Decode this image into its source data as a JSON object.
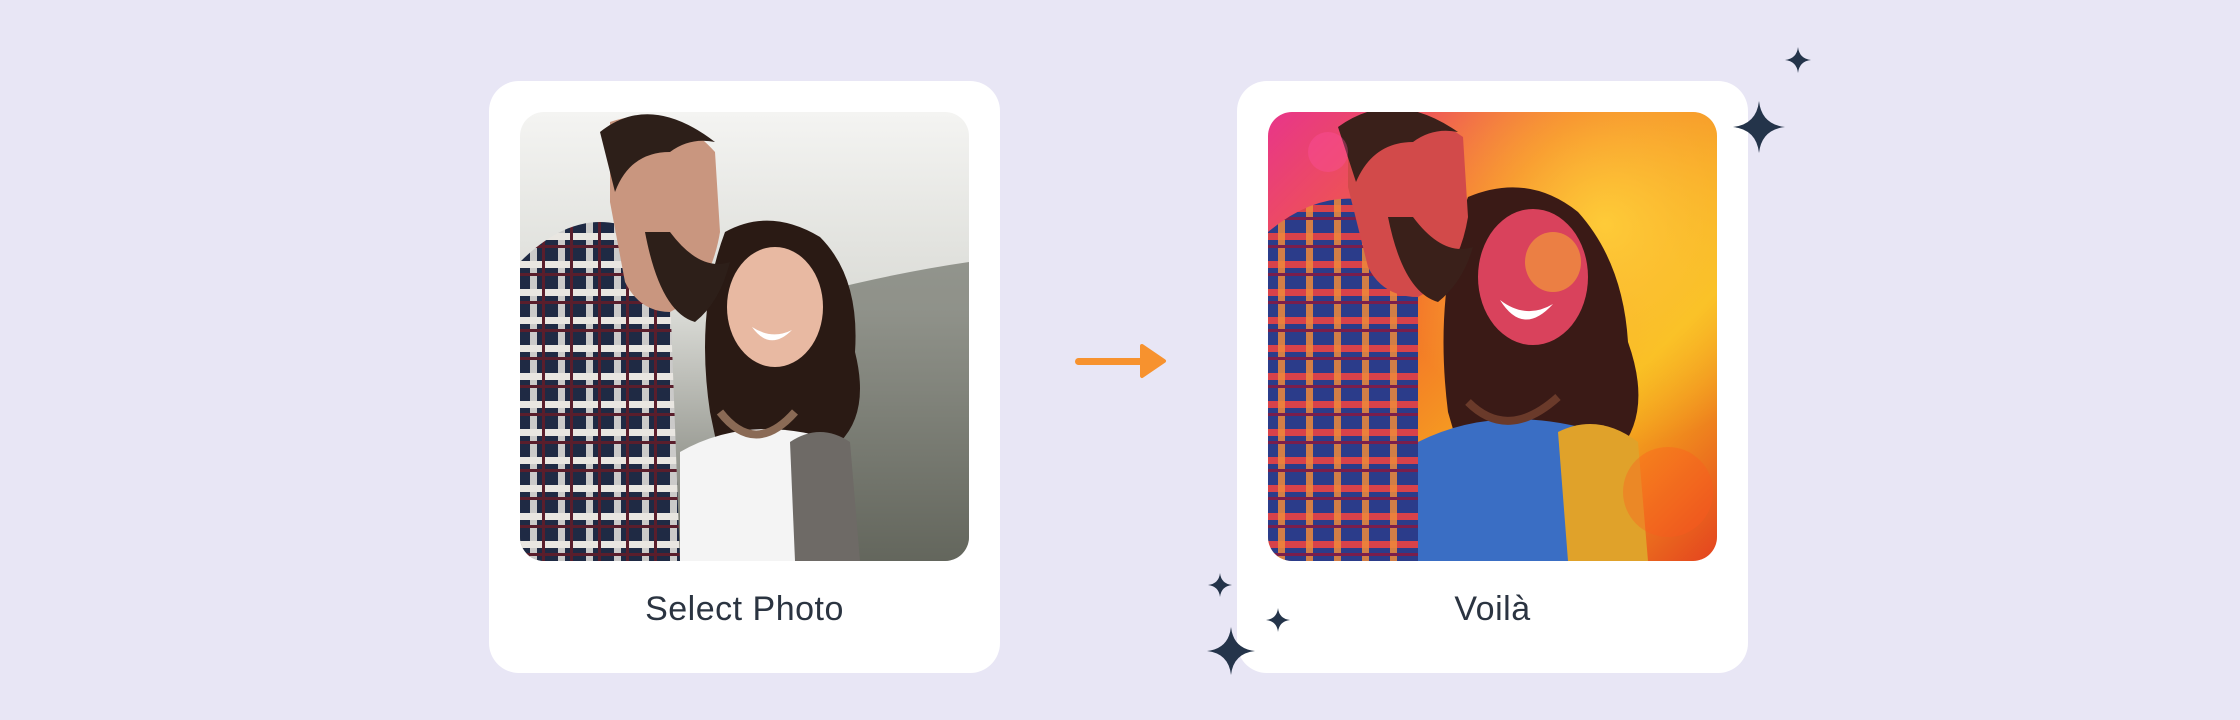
{
  "cards": {
    "before": {
      "caption": "Select Photo",
      "image": "original-couple-photo"
    },
    "after": {
      "caption": "Voilà",
      "image": "holi-colored-couple-photo"
    }
  },
  "arrow": {
    "icon": "arrow-right-icon",
    "color": "#f7922e"
  },
  "colors": {
    "background": "#e8e6f5",
    "card": "#ffffff",
    "caption_text": "#2b3441",
    "sparkle": "#24344a",
    "arrow": "#f7922e"
  }
}
